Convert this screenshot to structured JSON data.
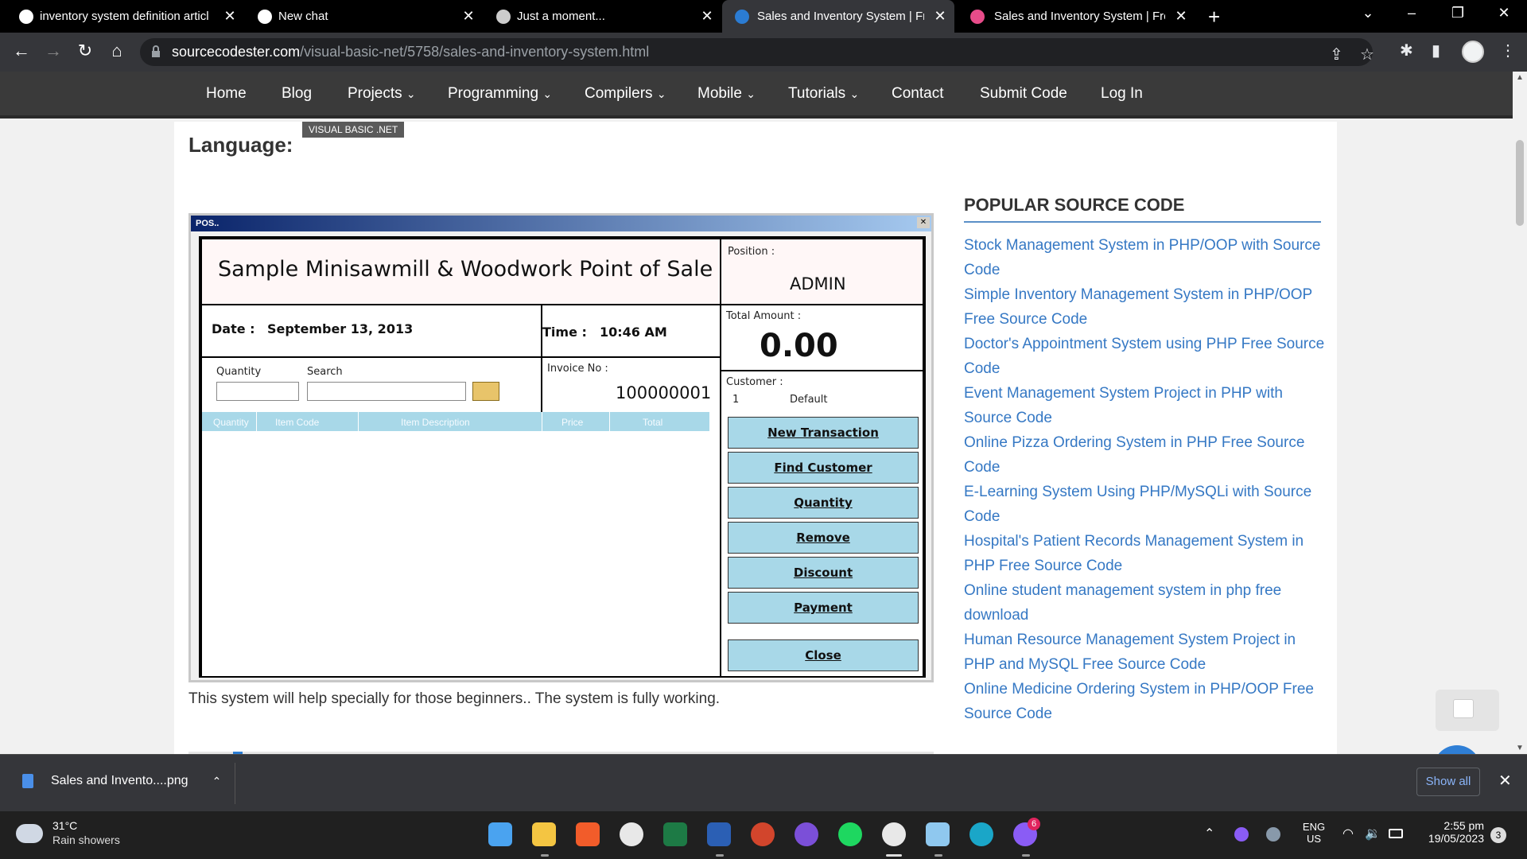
{
  "browser": {
    "tabs": [
      {
        "title": "inventory system definition articl",
        "icon": "google-icon"
      },
      {
        "title": "New chat",
        "icon": "chatgpt-icon"
      },
      {
        "title": "Just a moment...",
        "icon": "globe-icon"
      },
      {
        "title": "Sales and Inventory System | Free",
        "icon": "sourcecodester-icon",
        "active": true
      },
      {
        "title": "Sales and Inventory System | Free",
        "icon": "opera-icon"
      }
    ],
    "url_host": "sourcecodester.com",
    "url_path": "/visual-basic-net/5758/sales-and-inventory-system.html"
  },
  "site_nav": {
    "items": [
      "Home",
      "Blog",
      "Projects",
      "Programming",
      "Compilers",
      "Mobile",
      "Tutorials",
      "Contact",
      "Submit Code",
      "Log In"
    ],
    "dropdown_marker": "⌄"
  },
  "article": {
    "language_label": "Language:",
    "language_value": "VISUAL BASIC .NET",
    "caption": "This system will help specially for those beginners.. The system is fully working."
  },
  "pos_screenshot": {
    "window_title": "POS..",
    "store_name": "Sample Minisawmill & Woodwork Point of Sale",
    "position_label": "Position :",
    "position_value": "ADMIN",
    "date_label": "Date :",
    "date_value": "September 13, 2013",
    "time_label": "Time :",
    "time_value": "10:46 AM",
    "total_label": "Total Amount :",
    "total_value": "0.00",
    "quantity_label": "Quantity",
    "search_label": "Search",
    "invoice_label": "Invoice No :",
    "invoice_value": "100000001",
    "customer_label": "Customer :",
    "customer_id": "1",
    "customer_name": "Default",
    "grid_columns": [
      "Quantity",
      "Item Code",
      "Item Description",
      "Price",
      "Total"
    ],
    "buttons": [
      "New Transaction",
      "Find Customer",
      "Quantity",
      "Remove",
      "Discount",
      "Payment"
    ],
    "close_button": "Close"
  },
  "sidebar": {
    "title": "POPULAR SOURCE CODE",
    "links": [
      "Stock Management System in PHP/OOP with Source Code",
      "Simple Inventory Management System in PHP/OOP Free Source Code",
      "Doctor's Appointment System using PHP Free Source Code",
      "Event Management System Project in PHP with Source Code",
      "Online Pizza Ordering System in PHP Free Source Code",
      "E-Learning System Using PHP/MySQLi with Source Code",
      "Hospital's Patient Records Management System in PHP Free Source Code",
      "Online student management system in php free download",
      "Human Resource Management System Project in PHP and MySQL Free Source Code",
      "Online Medicine Ordering System in PHP/OOP Free Source Code"
    ]
  },
  "download_bar": {
    "file": "Sales and Invento....png",
    "show_all": "Show all"
  },
  "taskbar": {
    "temperature": "31°C",
    "weather": "Rain showers",
    "lang_top": "ENG",
    "lang_bottom": "US",
    "time": "2:55 pm",
    "date": "19/05/2023",
    "notification_count": "3",
    "messenger_badge": "6"
  },
  "colors": {
    "link": "#3578c4",
    "nav_bg": "#3a3a3a",
    "pos_button": "#a8d8e8"
  }
}
